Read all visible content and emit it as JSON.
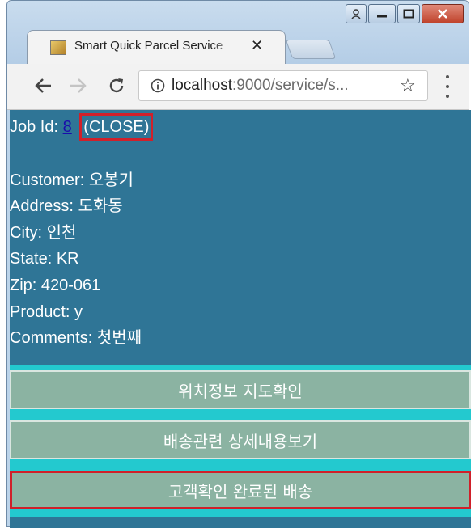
{
  "browser": {
    "tab_title": "Smart Quick Parcel Service",
    "tab_close": "✕",
    "url_host": "localhost",
    "url_rest": ":9000/service/s...",
    "star": "☆"
  },
  "job": {
    "label": "Job Id:",
    "id": "8",
    "status": "(CLOSE)"
  },
  "details": [
    {
      "label": "Customer:",
      "value": "오봉기"
    },
    {
      "label": "Address:",
      "value": "도화동"
    },
    {
      "label": "City:",
      "value": "인천"
    },
    {
      "label": "State:",
      "value": "KR"
    },
    {
      "label": "Zip:",
      "value": "420-061"
    },
    {
      "label": "Product:",
      "value": "y"
    },
    {
      "label": "Comments:",
      "value": "첫번째"
    }
  ],
  "buttons": {
    "map": "위치정보 지도확인",
    "details": "배송관련 상세내용보기",
    "confirmed": "고객확인 완료된 배송"
  }
}
